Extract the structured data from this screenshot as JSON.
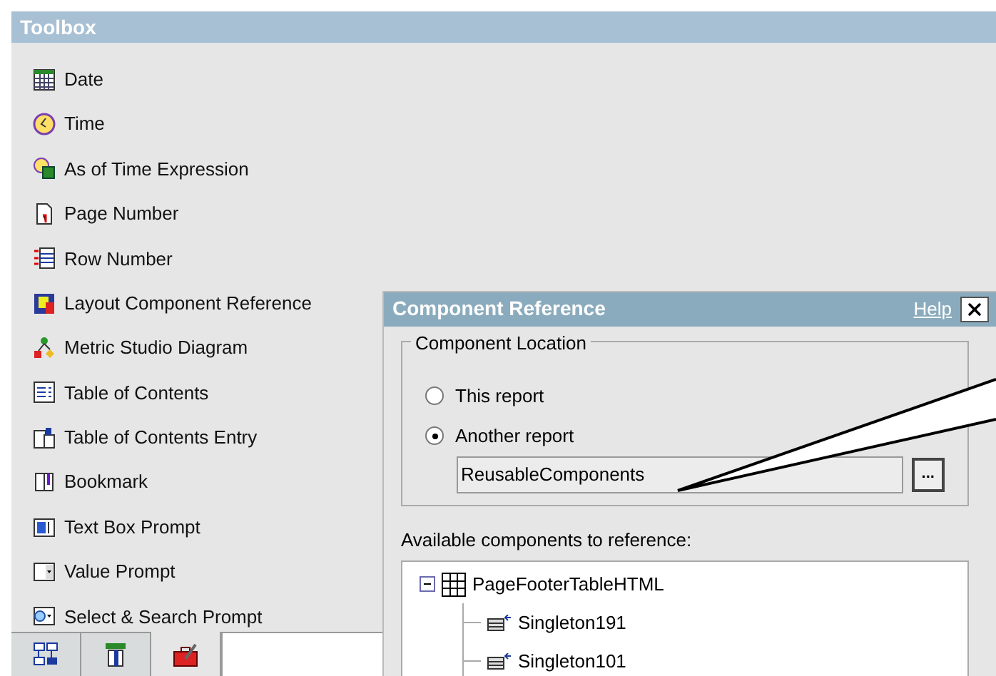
{
  "toolbox": {
    "title": "Toolbox",
    "items": [
      {
        "label": "Date"
      },
      {
        "label": "Time"
      },
      {
        "label": "As of Time Expression"
      },
      {
        "label": "Page Number"
      },
      {
        "label": "Row Number"
      },
      {
        "label": "Layout Component Reference"
      },
      {
        "label": "Metric Studio Diagram"
      },
      {
        "label": "Table of Contents"
      },
      {
        "label": "Table of Contents Entry"
      },
      {
        "label": "Bookmark"
      },
      {
        "label": "Text Box Prompt"
      },
      {
        "label": "Value Prompt"
      },
      {
        "label": "Select & Search Prompt"
      }
    ],
    "tabs": [
      {
        "selected": false
      },
      {
        "selected": false
      },
      {
        "selected": true
      }
    ]
  },
  "dialog": {
    "title": "Component Reference",
    "help": "Help",
    "location": {
      "legend": "Component Location",
      "options": [
        {
          "label": "This report",
          "selected": false
        },
        {
          "label": "Another report",
          "selected": true
        }
      ],
      "report_value": "ReusableComponents",
      "browse_button": "..."
    },
    "components_label": "Available components to reference:",
    "tree": [
      {
        "label": "PageFooterTableHTML",
        "expanded": true,
        "children": [
          {
            "label": "Singleton191"
          },
          {
            "label": "Singleton101"
          }
        ]
      }
    ]
  }
}
